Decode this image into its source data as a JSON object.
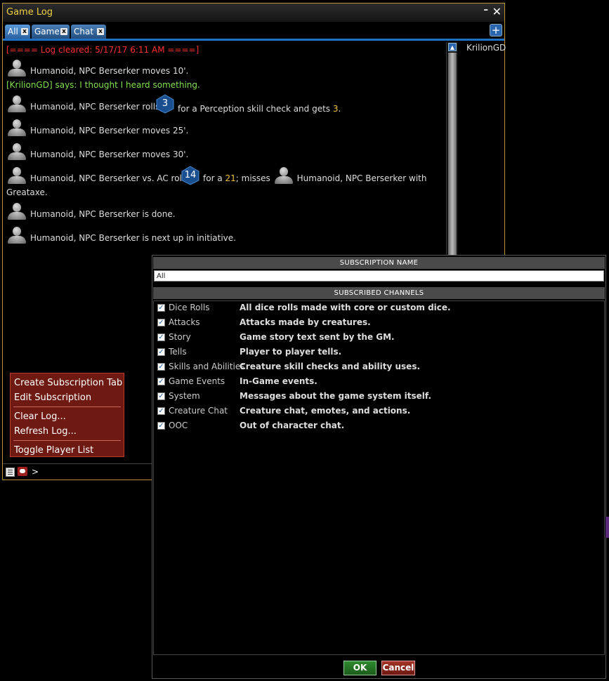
{
  "window": {
    "title": "Game Log",
    "minimize": "–",
    "close": "✕"
  },
  "tabs": [
    {
      "label": "All",
      "close": "x"
    },
    {
      "label": "Game",
      "close": "x"
    },
    {
      "label": "Chat",
      "close": "x"
    }
  ],
  "add_tab": "+",
  "player_list": [
    "KrilionGD"
  ],
  "log": {
    "cleared": "[==== Log cleared: 5/17/17 6:11 AM ====]",
    "l1": "Humanoid, NPC Berserker moves 10'.",
    "l2": "[KrilionGD] says: I thought I heard something.",
    "l3a": "Humanoid, NPC Berserker rolls",
    "l3_die": "3",
    "l3b": "for a Perception skill check and gets",
    "l3_result": "3",
    "l3c": ".",
    "l4": "Humanoid, NPC Berserker moves 25'.",
    "l5": "Humanoid, NPC Berserker moves 30'.",
    "l6a": "Humanoid, NPC Berserker vs. AC rolls",
    "l6_die": "14",
    "l6b": "for a",
    "l6_result": "21",
    "l6c": "; misses",
    "l6d": "Humanoid, NPC Berserker with",
    "l6e": "Greataxe.",
    "l7": "Humanoid, NPC Berserker is done.",
    "l8": "Humanoid, NPC Berserker is next up in initiative."
  },
  "chat_prompt": ">",
  "context_menu": [
    "Create Subscription Tab",
    "Edit Subscription",
    "Clear Log...",
    "Refresh Log...",
    "Toggle Player List"
  ],
  "subscription": {
    "name_header": "SUBSCRIPTION NAME",
    "name_value": "All",
    "channels_header": "SUBSCRIBED CHANNELS",
    "channels": [
      {
        "name": "Dice Rolls",
        "desc": "All dice rolls made with core or custom dice.",
        "checked": true
      },
      {
        "name": "Attacks",
        "desc": "Attacks made by creatures.",
        "checked": true
      },
      {
        "name": "Story",
        "desc": "Game story text sent by the GM.",
        "checked": true
      },
      {
        "name": "Tells",
        "desc": "Player to player tells.",
        "checked": true
      },
      {
        "name": "Skills and Abilities",
        "desc": "Creature skill checks and ability uses.",
        "checked": true
      },
      {
        "name": "Game Events",
        "desc": "In-Game events.",
        "checked": true
      },
      {
        "name": "System",
        "desc": "Messages about the game system itself.",
        "checked": true
      },
      {
        "name": "Creature Chat",
        "desc": "Creature chat, emotes, and actions.",
        "checked": true
      },
      {
        "name": "OOC",
        "desc": "Out of character chat.",
        "checked": true
      }
    ],
    "ok": "OK",
    "cancel": "Cancel"
  },
  "colors": {
    "title": "#f0d040",
    "accent_blue": "#2070c0",
    "log_cleared": "#ff3030",
    "player_says": "#7fe04f",
    "roll_result": "#f0c040",
    "menu_bg": "#6e1a12",
    "ok_green": "#2f8a2f",
    "cancel_red": "#a43426"
  }
}
